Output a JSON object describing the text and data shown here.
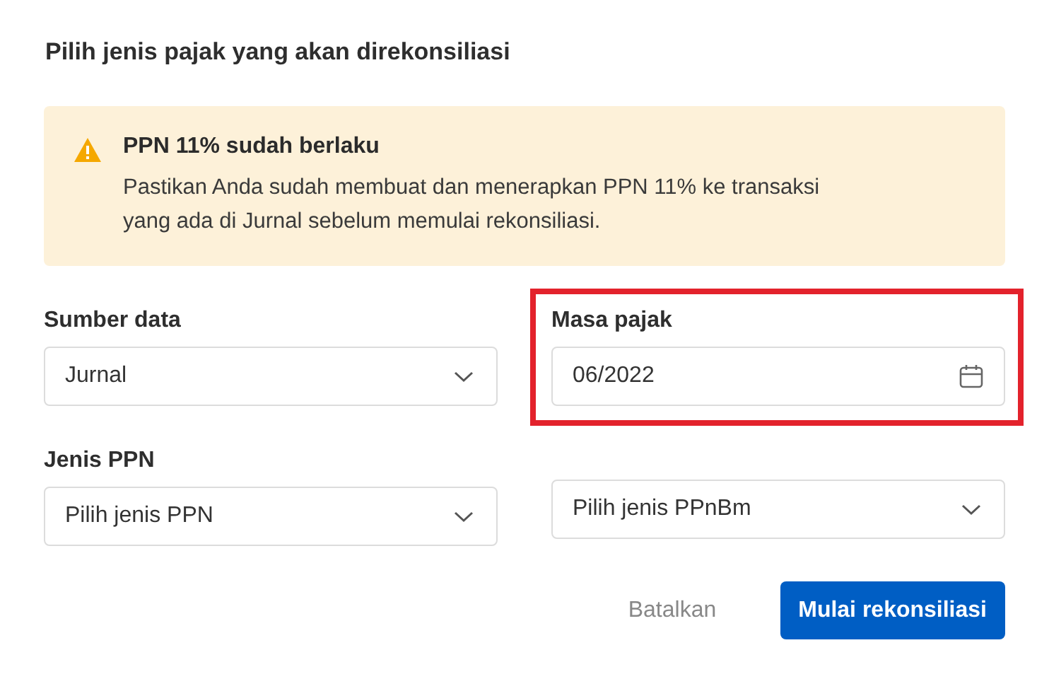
{
  "dialog": {
    "title": "Pilih jenis pajak yang akan direkonsiliasi"
  },
  "alert": {
    "kind": "warning",
    "title": "PPN 11% sudah berlaku",
    "message": "Pastikan Anda sudah membuat dan menerapkan PPN 11% ke transaksi yang ada di Jurnal sebelum memulai rekonsiliasi."
  },
  "fields": [
    {
      "kind": "select",
      "label": "Sumber data",
      "value": "Jurnal",
      "highlighted": false
    },
    {
      "kind": "date",
      "label": "Masa pajak",
      "value": "06/2022",
      "highlighted": true
    },
    {
      "kind": "select",
      "label": "Jenis PPN",
      "placeholder": "Pilih jenis PPN",
      "highlighted": false
    },
    {
      "kind": "select",
      "placeholder": "Pilih jenis PPnBm",
      "highlighted": false
    }
  ],
  "buttons": [
    {
      "kind": "secondary",
      "label": "Batalkan"
    },
    {
      "kind": "primary",
      "label": "Mulai rekonsiliasi"
    }
  ]
}
